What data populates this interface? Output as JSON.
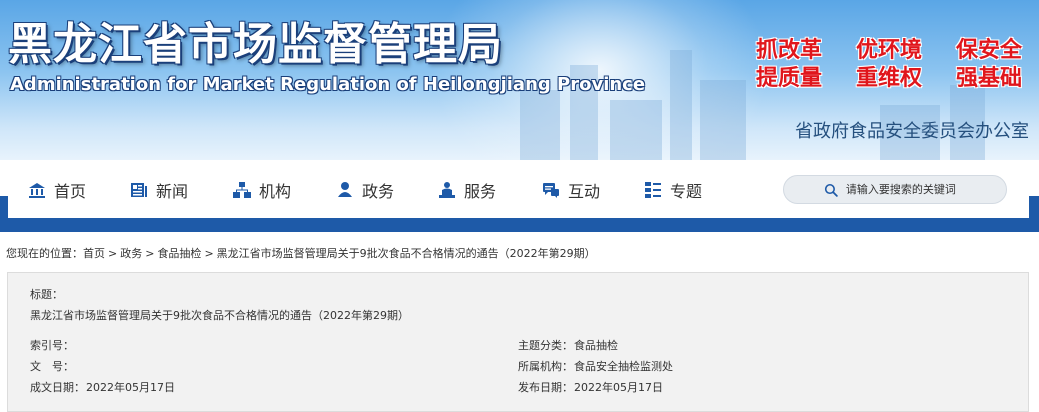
{
  "header": {
    "title_cn": "黑龙江省市场监督管理局",
    "title_en": "Administration for Market Regulation of Heilongjiang Province",
    "slogans": [
      "抓改革",
      "优环境",
      "保安全",
      "提质量",
      "重维权",
      "强基础"
    ],
    "office": "省政府食品安全委员会办公室"
  },
  "nav": {
    "items": [
      {
        "label": "首页",
        "icon": "home-icon"
      },
      {
        "label": "新闻",
        "icon": "newspaper-icon"
      },
      {
        "label": "机构",
        "icon": "org-chart-icon"
      },
      {
        "label": "政务",
        "icon": "person-icon"
      },
      {
        "label": "服务",
        "icon": "service-icon"
      },
      {
        "label": "互动",
        "icon": "chat-icon"
      },
      {
        "label": "专题",
        "icon": "topic-icon"
      }
    ],
    "search_placeholder": "请输入要搜索的关键词"
  },
  "breadcrumb": {
    "prefix": "您现在的位置：",
    "items": [
      "首页",
      "政务",
      "食品抽检",
      "黑龙江省市场监督管理局关于9批次食品不合格情况的通告（2022年第29期）"
    ],
    "separator": ">"
  },
  "info": {
    "title_label": "标题：",
    "title_value": "黑龙江省市场监督管理局关于9批次食品不合格情况的通告（2022年第29期）",
    "index_label": "索引号：",
    "index_value": "",
    "doc_label": "文　号：",
    "doc_value": "",
    "date_made_label": "成文日期：",
    "date_made_value": "2022年05月17日",
    "category_label": "主题分类：",
    "category_value": "食品抽检",
    "org_label": "所属机构：",
    "org_value": "食品安全抽检监测处",
    "pub_label": "发布日期：",
    "pub_value": "2022年05月17日"
  },
  "colors": {
    "nav_bar_blue": "#1e5aa8",
    "slogan_red": "#e0161c",
    "banner_sky": "#5aa6e6",
    "info_bg": "#f2f2f2"
  }
}
